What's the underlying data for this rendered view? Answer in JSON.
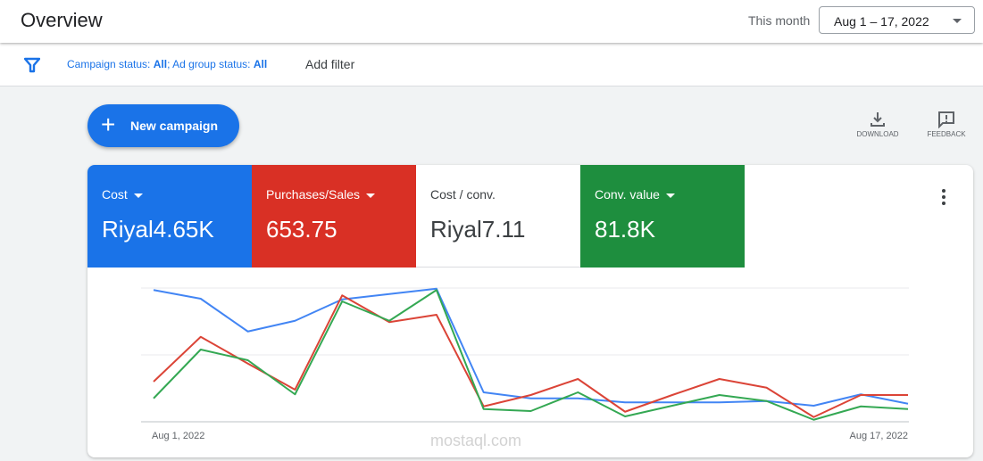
{
  "header": {
    "title": "Overview",
    "range_label": "This month",
    "date_range": "Aug 1 – 17, 2022"
  },
  "filters": {
    "campaign_label": "Campaign status: ",
    "campaign_value": "All",
    "sep": "; ",
    "adgroup_label": "Ad group status: ",
    "adgroup_value": "All",
    "add_filter": "Add filter"
  },
  "actions": {
    "new_campaign": "New campaign",
    "download": "DOWNLOAD",
    "feedback": "FEEDBACK"
  },
  "metrics": [
    {
      "name": "Cost",
      "value": "Riyal4.65K",
      "color": "#1a73e8",
      "dropdown": true
    },
    {
      "name": "Purchases/Sales",
      "value": "653.75",
      "color": "#d93025",
      "dropdown": true
    },
    {
      "name": "Cost / conv.",
      "value": "Riyal7.11",
      "color": "#ffffff",
      "dropdown": false
    },
    {
      "name": "Conv. value",
      "value": "81.8K",
      "color": "#1e8e3e",
      "dropdown": true
    }
  ],
  "watermark": "mostaql.com",
  "chart_data": {
    "type": "line",
    "x_start_label": "Aug 1, 2022",
    "x_end_label": "Aug 17, 2022",
    "x": [
      "Aug 1",
      "Aug 2",
      "Aug 3",
      "Aug 4",
      "Aug 5",
      "Aug 6",
      "Aug 7",
      "Aug 8",
      "Aug 9",
      "Aug 10",
      "Aug 11",
      "Aug 12",
      "Aug 13",
      "Aug 14",
      "Aug 15",
      "Aug 16",
      "Aug 17"
    ],
    "ylim": [
      0,
      2
    ],
    "grid": true,
    "series": [
      {
        "color": "#4285f4",
        "values": [
          1.97,
          1.84,
          1.35,
          1.51,
          1.83,
          1.91,
          1.99,
          0.44,
          0.35,
          0.35,
          0.29,
          0.29,
          0.29,
          0.31,
          0.24,
          0.41,
          0.27
        ]
      },
      {
        "color": "#db4437",
        "values": [
          0.6,
          1.27,
          0.87,
          0.48,
          1.89,
          1.49,
          1.6,
          0.23,
          0.4,
          0.64,
          0.15,
          0.4,
          0.64,
          0.51,
          0.07,
          0.4,
          0.4
        ]
      },
      {
        "color": "#34a853",
        "values": [
          0.35,
          1.08,
          0.92,
          0.41,
          1.8,
          1.51,
          1.97,
          0.19,
          0.16,
          0.44,
          0.08,
          0.24,
          0.4,
          0.31,
          0.03,
          0.23,
          0.19
        ]
      }
    ]
  }
}
